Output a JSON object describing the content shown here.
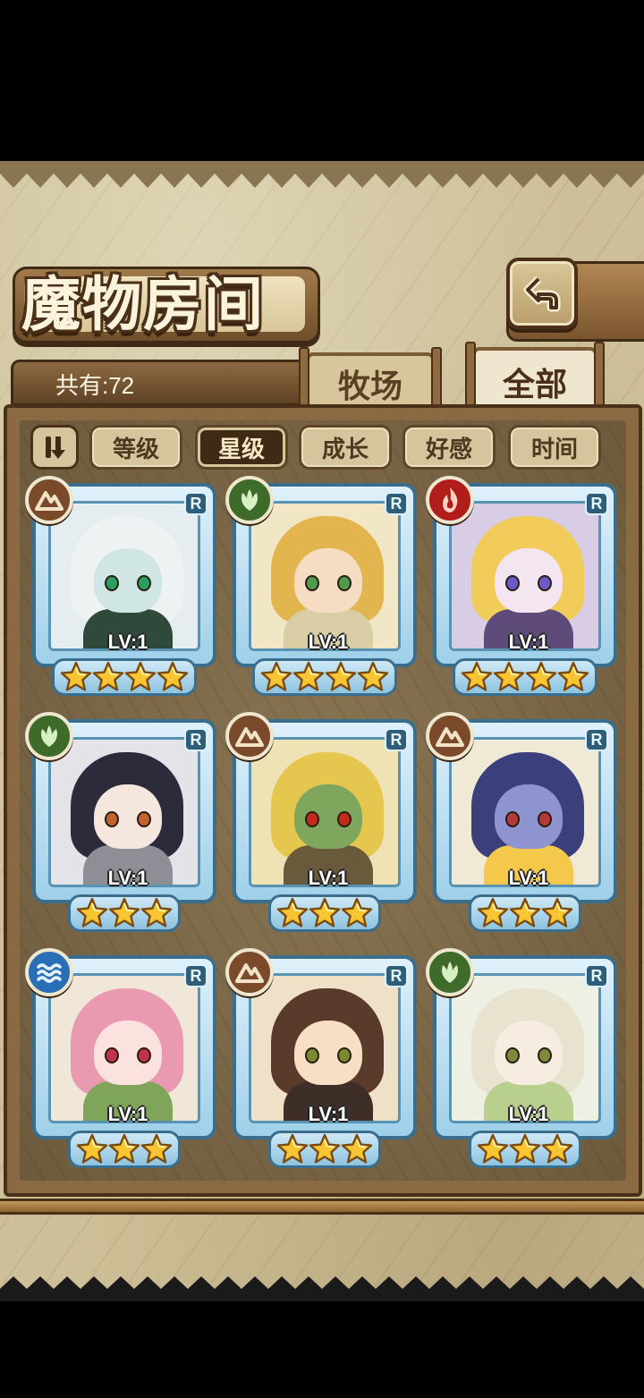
{
  "header": {
    "title": "魔物房间",
    "back_icon": "return-arrow-icon"
  },
  "summary": {
    "count_label": "共有:72"
  },
  "tabs": [
    {
      "label": "牧场",
      "active": false
    },
    {
      "label": "全部",
      "active": true
    }
  ],
  "sort": {
    "toggle_icon": "sort-order-icon",
    "options": [
      {
        "label": "等级",
        "active": false
      },
      {
        "label": "星级",
        "active": true
      },
      {
        "label": "成长",
        "active": false
      },
      {
        "label": "好感",
        "active": false
      },
      {
        "label": "时间",
        "active": false
      }
    ]
  },
  "colors": {
    "earth": "#7a4a2a",
    "nature": "#3e6b2a",
    "fire": "#b01d1a",
    "water": "#2a6fb6"
  },
  "monsters": [
    {
      "element": "earth",
      "rank": "R",
      "level": "LV:1",
      "stars": 4,
      "hair": "#eef2f3",
      "skin": "#cfe6e4",
      "eye": "#2e9d62",
      "outfit": "#2f4a3a",
      "bg": "#e6edf0"
    },
    {
      "element": "nature",
      "rank": "R",
      "level": "LV:1",
      "stars": 4,
      "hair": "#e3b54e",
      "skin": "#f6dcc2",
      "eye": "#4f9a4b",
      "outfit": "#d9cda6",
      "bg": "#f1e6c6"
    },
    {
      "element": "fire",
      "rank": "R",
      "level": "LV:1",
      "stars": 4,
      "hair": "#f1cc5a",
      "skin": "#f4e6f0",
      "eye": "#6a5bc8",
      "outfit": "#5e4b7a",
      "bg": "#d8cde4"
    },
    {
      "element": "nature",
      "rank": "R",
      "level": "LV:1",
      "stars": 3,
      "hair": "#2c2b3c",
      "skin": "#f6e7de",
      "eye": "#c0632f",
      "outfit": "#8e8f96",
      "bg": "#e3e3e8"
    },
    {
      "element": "earth",
      "rank": "R",
      "level": "LV:1",
      "stars": 3,
      "hair": "#e5c64f",
      "skin": "#7ea75d",
      "eye": "#c42b1d",
      "outfit": "#6a5a3c",
      "bg": "#efe3b6"
    },
    {
      "element": "earth",
      "rank": "R",
      "level": "LV:1",
      "stars": 3,
      "hair": "#3b3f7c",
      "skin": "#8d94cf",
      "eye": "#b23a3a",
      "outfit": "#f4c94b",
      "bg": "#efe9d6"
    },
    {
      "element": "water",
      "rank": "R",
      "level": "LV:1",
      "stars": 3,
      "hair": "#e99ab1",
      "skin": "#fbe2df",
      "eye": "#c0334c",
      "outfit": "#7fa55b",
      "bg": "#f0e7d9"
    },
    {
      "element": "earth",
      "rank": "R",
      "level": "LV:1",
      "stars": 3,
      "hair": "#5a3a2a",
      "skin": "#f6dfc4",
      "eye": "#7b8a2a",
      "outfit": "#3d2f27",
      "bg": "#efe1c7"
    },
    {
      "element": "nature",
      "rank": "R",
      "level": "LV:1",
      "stars": 3,
      "hair": "#e8e3cf",
      "skin": "#f7ece0",
      "eye": "#7d8a3a",
      "outfit": "#b9cf8e",
      "bg": "#eef0e4"
    }
  ]
}
